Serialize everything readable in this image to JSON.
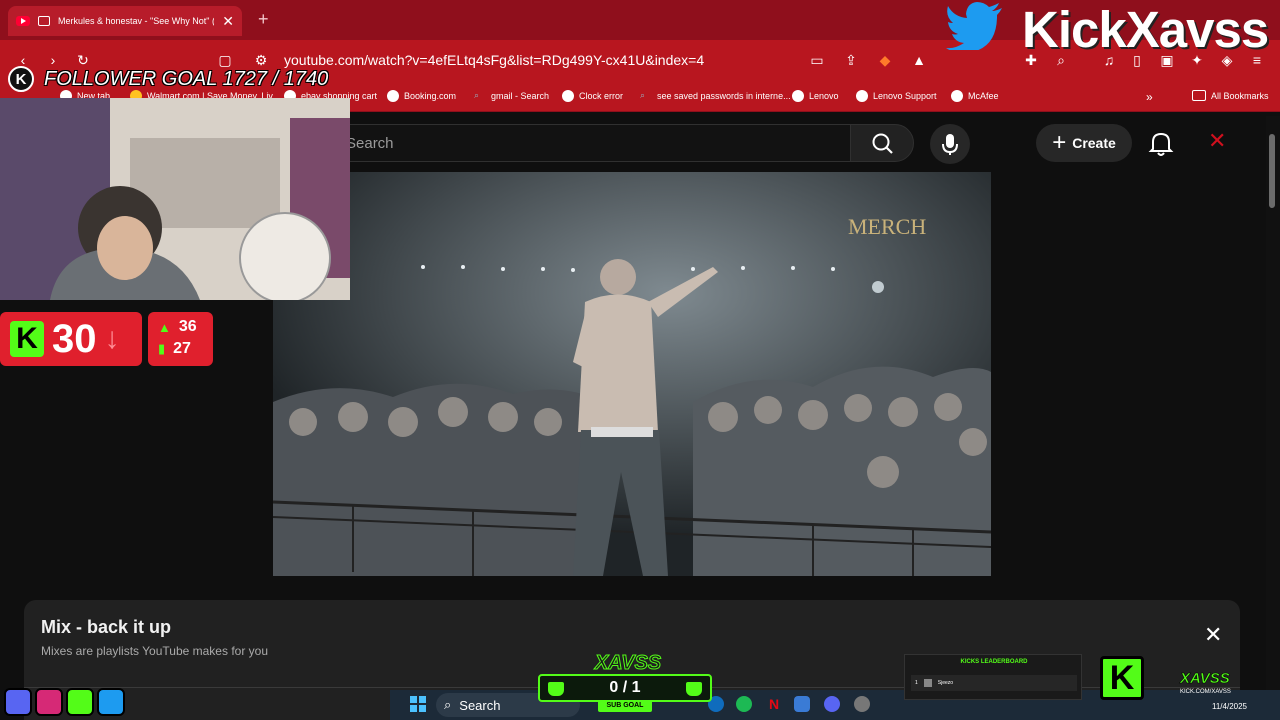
{
  "browser": {
    "tab_title": "Merkules & honestav - \"See Why Not\" (Offic",
    "url": "youtube.com/watch?v=4efELtq4sFg&list=RDg499Y-cx41U&index=4",
    "bookmarks": [
      "New tab",
      "Walmart.com | Save Money. Liv...",
      "ebay shopping cart",
      "Booking.com",
      "gmail - Search",
      "Clock error",
      "see saved passwords in interne...",
      "Lenovo",
      "Lenovo Support",
      "McAfee"
    ],
    "all_bookmarks": "All Bookmarks"
  },
  "youtube": {
    "search_placeholder": "Search",
    "create_label": "Create"
  },
  "video": {
    "sign_text": "MERCH"
  },
  "mix": {
    "title": "Mix - back it up",
    "subtitle": "Mixes are playlists YouTube makes for you"
  },
  "taskbar": {
    "search_label": "Search",
    "date": "11/4/2025"
  },
  "overlay": {
    "banner": "KickXavss",
    "follower_goal": "FOLLOWER GOAL 1727 / 1740",
    "kick_count": "30",
    "stat_up": "36",
    "stat_bars": "27",
    "sub_goal_brand": "XAVSS",
    "sub_goal_count": "0 / 1",
    "sub_goal_label": "SUB GOAL",
    "leaderboard_title": "KICKS LEADERBOARD",
    "leaderboard_rank": "1",
    "leaderboard_user": "Sjeezo",
    "badge_name": "XAVSS",
    "badge_url": "KICK.COM/XAVSS"
  },
  "colors": {
    "browser_red": "#b8161f",
    "kick_green": "#53fc18",
    "overlay_red": "#e0202d"
  }
}
